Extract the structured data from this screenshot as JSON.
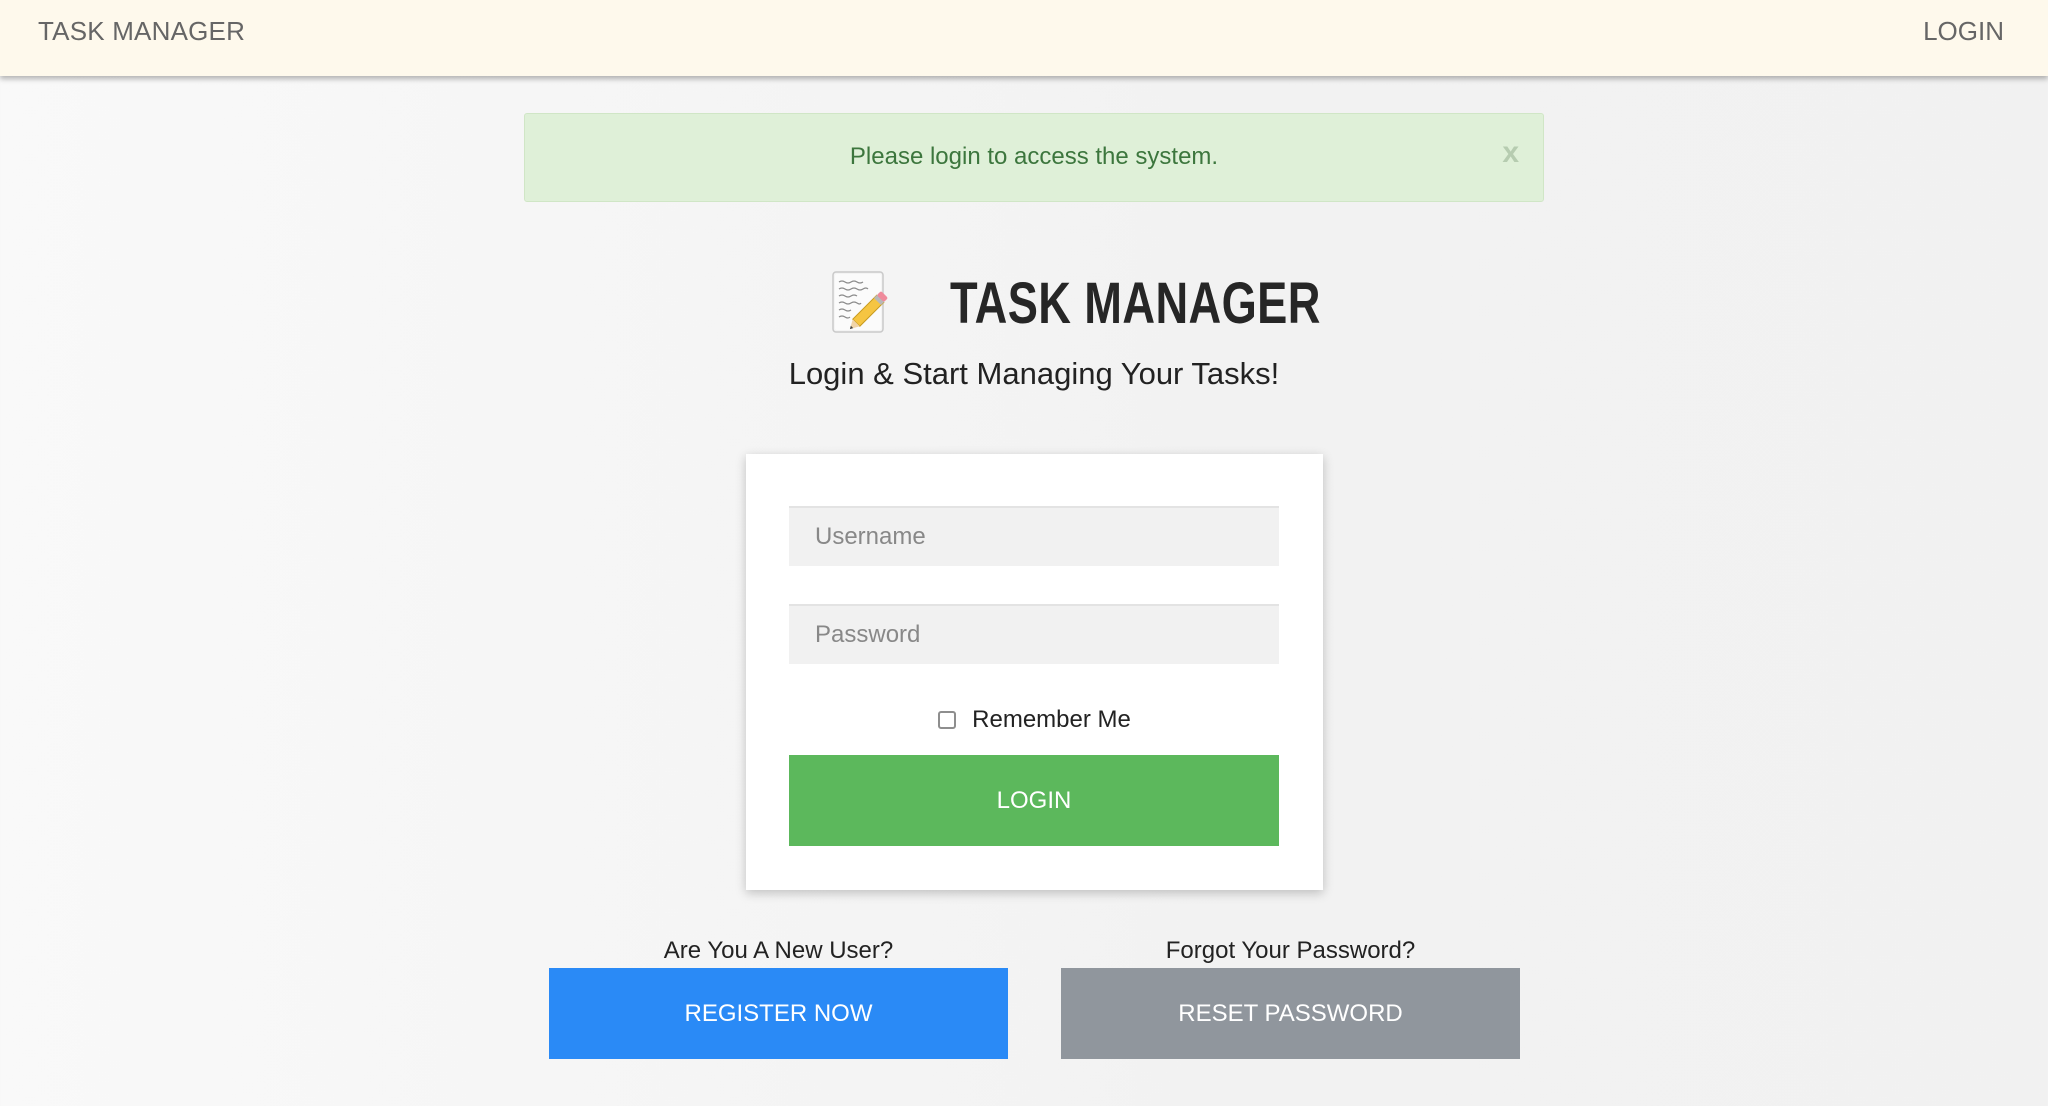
{
  "navbar": {
    "brand": "TASK MANAGER",
    "login_link": "LOGIN"
  },
  "alert": {
    "message": "Please login to access the system.",
    "close_label": "x"
  },
  "header": {
    "logo_icon": "memo-pencil-icon",
    "title": "TASK MANAGER",
    "subtitle": "Login & Start Managing Your Tasks!"
  },
  "login_form": {
    "username_placeholder": "Username",
    "username_value": "",
    "password_placeholder": "Password",
    "password_value": "",
    "remember_label": "Remember Me",
    "remember_checked": false,
    "submit_label": "LOGIN"
  },
  "register": {
    "prompt": "Are You A New User?",
    "button_label": "REGISTER NOW"
  },
  "reset": {
    "prompt": "Forgot Your Password?",
    "button_label": "RESET PASSWORD"
  },
  "colors": {
    "navbar_bg": "#fef9ec",
    "alert_bg": "#dff0d8",
    "alert_text": "#3c763d",
    "login_button": "#5cb85c",
    "register_button": "#2a8af6",
    "reset_button": "#90969d"
  }
}
